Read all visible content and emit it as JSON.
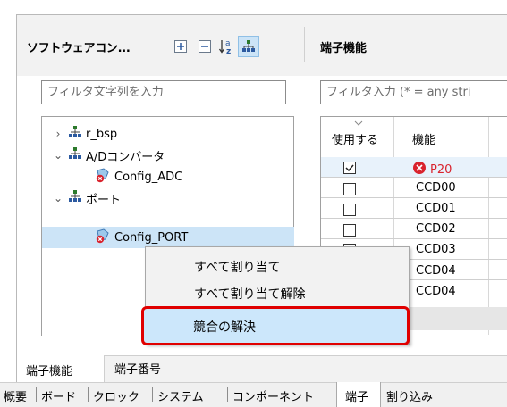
{
  "left_panel": {
    "title": "ソフトウェアコン...",
    "filter_placeholder": "フィルタ文字列を入力",
    "tree": [
      {
        "label": "r_bsp"
      },
      {
        "label": "A/Dコンバータ"
      },
      {
        "label": "Config_ADC"
      },
      {
        "label": "ポート"
      },
      {
        "label": "Config_PORT"
      }
    ]
  },
  "right_panel": {
    "title": "端子機能",
    "filter_placeholder": "フィルタ入力 (* = any stri",
    "columns": {
      "use": "使用する",
      "function": "機能"
    },
    "rows": [
      {
        "checked": true,
        "function": "P20",
        "error": true
      },
      {
        "checked": false,
        "function": "CCD00"
      },
      {
        "checked": false,
        "function": "CCD01"
      },
      {
        "checked": false,
        "function": "CCD02"
      },
      {
        "checked": false,
        "function": "CCD03"
      },
      {
        "checked": false,
        "function": "CCD04"
      }
    ]
  },
  "context_menu": {
    "items": [
      "すべて割り当て",
      "すべて割り当て解除",
      "競合の解決"
    ],
    "highlighted": "競合の解決"
  },
  "view_tabs": [
    "端子機能",
    "端子番号"
  ],
  "bottom_tabs": [
    "概要",
    "ボード",
    "クロック",
    "システム",
    "コンポーネント",
    "端子",
    "割り込み"
  ],
  "colors": {
    "highlight_border": "#e00000",
    "highlight_fill": "#cce7fb",
    "error_red": "#d9232d"
  }
}
